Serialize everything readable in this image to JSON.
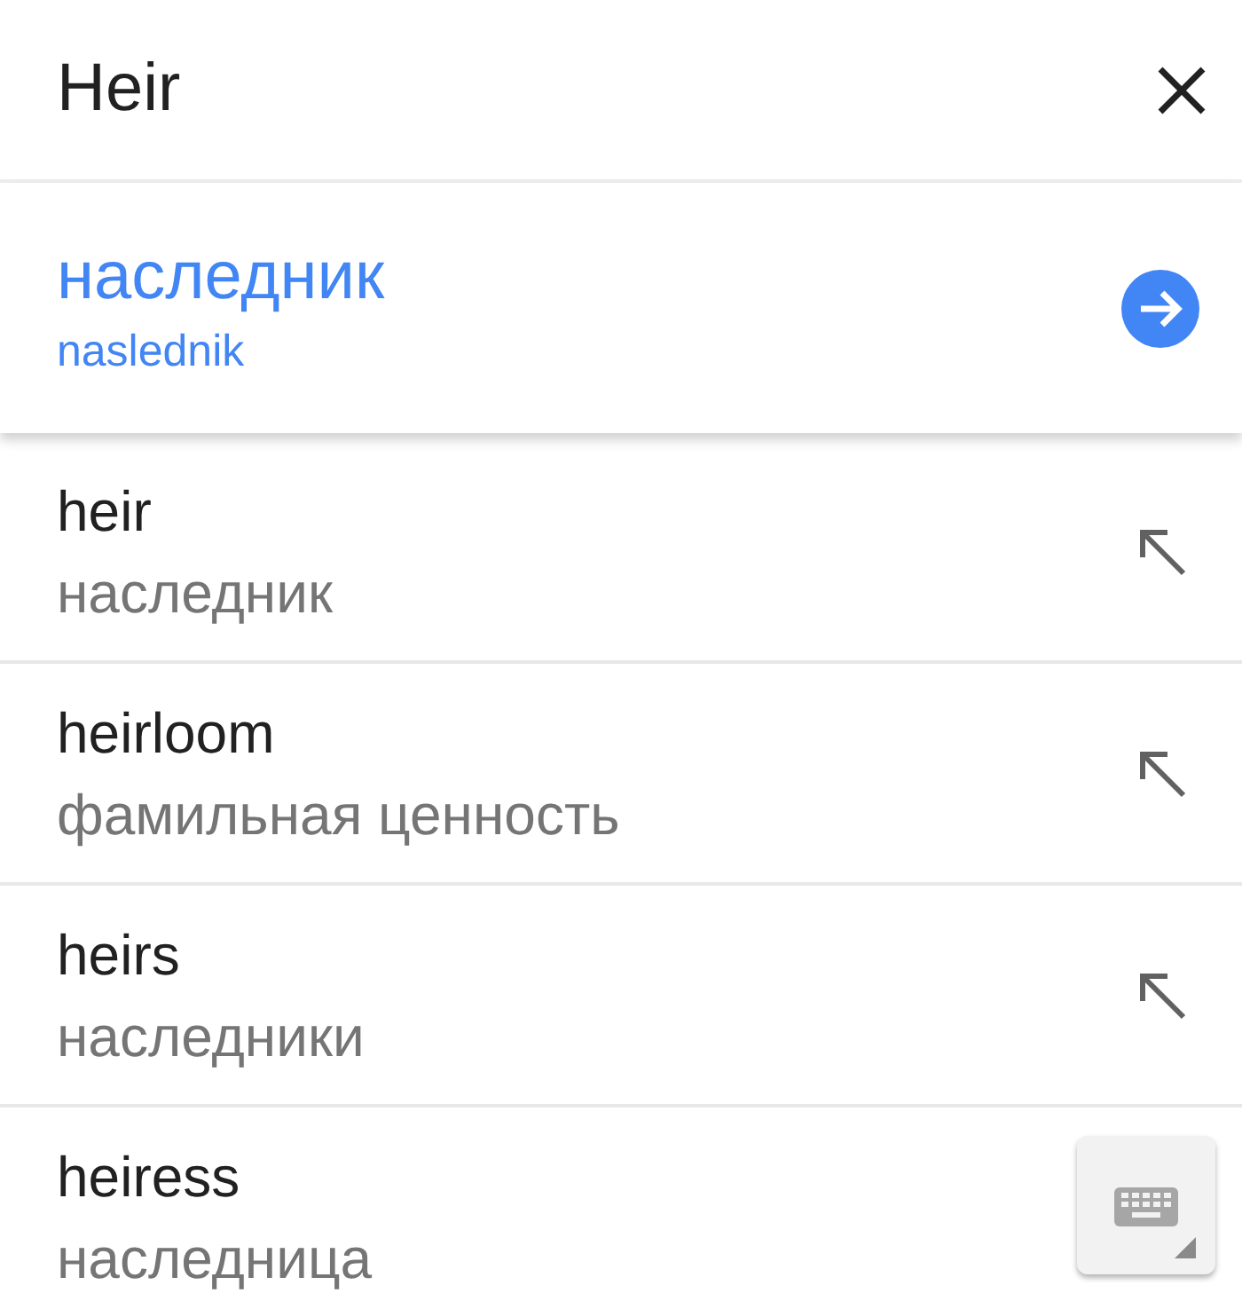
{
  "search": {
    "value": "Heir"
  },
  "result": {
    "translation": "наследник",
    "transliteration": "naslednik"
  },
  "suggestions": [
    {
      "word": "heir",
      "translation": "наследник",
      "fill_button": true
    },
    {
      "word": "heirloom",
      "translation": "фамильная ценность",
      "fill_button": true
    },
    {
      "word": "heirs",
      "translation": "наследники",
      "fill_button": true
    },
    {
      "word": "heiress",
      "translation": "наследница",
      "fill_button": false
    }
  ]
}
